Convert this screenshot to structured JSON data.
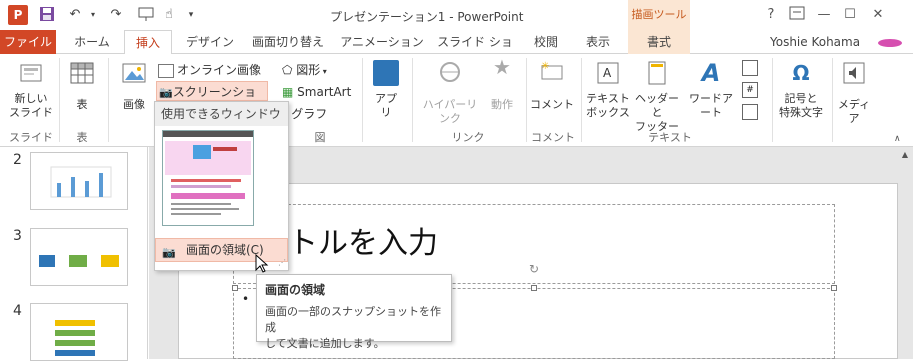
{
  "titlebar": {
    "logo": "P",
    "title": "プレゼンテーション1 - PowerPoint",
    "contextual_group": "描画ツール",
    "help": "?",
    "icons": [
      "save-icon",
      "undo-icon",
      "redo-icon",
      "present-icon",
      "touch-mode-icon",
      "customize-icon"
    ]
  },
  "tabs": [
    "ファイル",
    "ホーム",
    "挿入",
    "デザイン",
    "画面切り替え",
    "アニメーション",
    "スライド ショー",
    "校閲",
    "表示",
    "書式"
  ],
  "user": "Yoshie Kohama",
  "ribbon": {
    "new_slide": "新しい\nスライド",
    "new_slide_l1": "新しい",
    "new_slide_l2": "スライド",
    "table": "表",
    "image": "画像",
    "online_image": "オンライン画像",
    "screenshot": "スクリーンショット",
    "shapes": "図形",
    "smartart": "SmartArt",
    "graph": "グラフ",
    "apps_l1": "アプ",
    "apps_l2": "リ",
    "hyperlink": "ハイパーリンク",
    "action": "動作",
    "comment": "コメント",
    "textbox_l1": "テキスト",
    "textbox_l2": "ボックス",
    "header_l1": "ヘッダーと",
    "header_l2": "フッター",
    "wordart": "ワードアート",
    "symbol_l1": "記号と",
    "symbol_l2": "特殊文字",
    "media": "メディア",
    "groups": {
      "slide": "スライド",
      "table": "表",
      "figure": "図",
      "link": "リンク",
      "comment": "コメント",
      "text": "テキスト"
    }
  },
  "slides_pane": {
    "numbers": [
      "2",
      "3",
      "4"
    ]
  },
  "slide": {
    "title_text": "トルを入力",
    "bullet": "•"
  },
  "dropdown": {
    "header": "使用できるウィンドウ",
    "screen_clip": "画面の領域(C)"
  },
  "tooltip": {
    "title": "画面の領域",
    "desc_l1": "画面の一部のスナップショットを作成",
    "desc_l2": "して文書に追加します。"
  },
  "colors": {
    "accent": "#d24726",
    "contextual": "#fbe6d3",
    "insert_tab": "#c43e1c"
  }
}
